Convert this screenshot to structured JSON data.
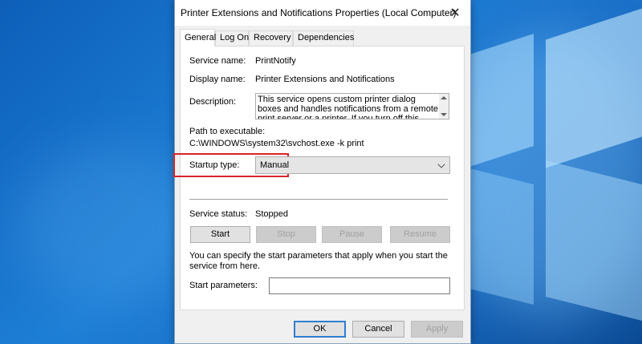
{
  "window": {
    "title": "Printer Extensions and Notifications Properties (Local Computer)",
    "close_symbol": "✕"
  },
  "tabs": [
    {
      "label": "General",
      "active": true
    },
    {
      "label": "Log On",
      "active": false
    },
    {
      "label": "Recovery",
      "active": false
    },
    {
      "label": "Dependencies",
      "active": false
    }
  ],
  "general": {
    "service_name_label": "Service name:",
    "service_name_value": "PrintNotify",
    "display_name_label": "Display name:",
    "display_name_value": "Printer Extensions and Notifications",
    "description_label": "Description:",
    "description_value": "This service opens custom printer dialog boxes and handles notifications from a remote print server or a printer. If you turn off this service, you won't be able",
    "path_label": "Path to executable:",
    "path_value": "C:\\WINDOWS\\system32\\svchost.exe -k print",
    "startup_type_label": "Startup type:",
    "startup_type_value": "Manual",
    "service_status_label": "Service status:",
    "service_status_value": "Stopped",
    "buttons": {
      "start": "Start",
      "stop": "Stop",
      "pause": "Pause",
      "resume": "Resume"
    },
    "start_params_info": "You can specify the start parameters that apply when you start the service from here.",
    "start_params_label": "Start parameters:",
    "start_params_value": ""
  },
  "footer": {
    "ok": "OK",
    "cancel": "Cancel",
    "apply": "Apply"
  },
  "colors": {
    "highlight": "#d9242a",
    "default_button_border": "#2f7dd1"
  }
}
